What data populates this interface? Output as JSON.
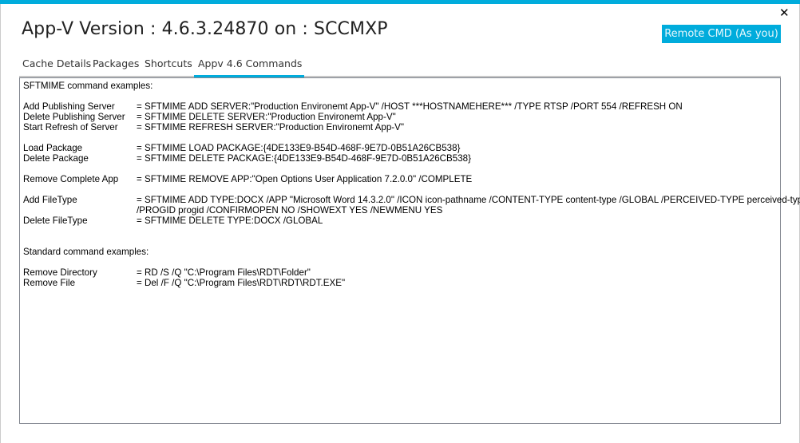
{
  "window": {
    "title": "App-V Version : 4.6.3.24870 on : SCCMXP",
    "close_icon": "close-icon",
    "accent_color": "#00acdc"
  },
  "toolbar": {
    "remote_cmd_label": "Remote CMD (As you)"
  },
  "tabs": [
    {
      "label": "Cache Details",
      "active": false
    },
    {
      "label": "Packages",
      "active": false
    },
    {
      "label": "Shortcuts",
      "active": false
    },
    {
      "label": "Appv 4.6 Commands",
      "active": true
    }
  ],
  "commands": {
    "lines": [
      {
        "label": "SFTMIME command examples:",
        "cmd": ""
      },
      {
        "label": "",
        "cmd": ""
      },
      {
        "label": "Add Publishing Server",
        "cmd": "= SFTMIME ADD SERVER:\"Production Environemt App-V\" /HOST ***HOSTNAMEHERE*** /TYPE RTSP /PORT 554 /REFRESH ON"
      },
      {
        "label": "Delete Publishing Server",
        "cmd": "= SFTMIME DELETE SERVER:\"Production Environemt App-V\""
      },
      {
        "label": "Start Refresh of Server",
        "cmd": "= SFTMIME REFRESH SERVER:\"Production Environemt App-V\""
      },
      {
        "label": "",
        "cmd": ""
      },
      {
        "label": "Load Package",
        "cmd": "= SFTMIME LOAD PACKAGE:{4DE133E9-B54D-468F-9E7D-0B51A26CB538}"
      },
      {
        "label": "Delete Package",
        "cmd": "= SFTMIME DELETE PACKAGE:{4DE133E9-B54D-468F-9E7D-0B51A26CB538}"
      },
      {
        "label": "",
        "cmd": ""
      },
      {
        "label": "Remove Complete App",
        "cmd": "= SFTMIME REMOVE APP:\"Open Options User Application 7.2.0.0\" /COMPLETE"
      },
      {
        "label": "",
        "cmd": ""
      },
      {
        "label": "Add FileType",
        "cmd": "= SFTMIME ADD TYPE:DOCX /APP \"Microsoft Word 14.3.2.0\" /ICON icon-pathname  /CONTENT-TYPE content-type /GLOBAL /PERCEIVED-TYPE perceived-type"
      },
      {
        "label": "",
        "cmd": "   /PROGID progid /CONFIRMOPEN NO /SHOWEXT YES /NEWMENU YES"
      },
      {
        "label": "Delete FileType",
        "cmd": "= SFTMIME DELETE TYPE:DOCX /GLOBAL"
      },
      {
        "label": "",
        "cmd": ""
      },
      {
        "label": "",
        "cmd": ""
      },
      {
        "label": "Standard command examples:",
        "cmd": ""
      },
      {
        "label": "",
        "cmd": ""
      },
      {
        "label": "Remove Directory",
        "cmd": "= RD /S /Q \"C:\\Program Files\\RDT\\Folder\""
      },
      {
        "label": "Remove File",
        "cmd": "= Del /F /Q \"C:\\Program Files\\RDT\\RDT\\RDT.EXE\""
      }
    ]
  }
}
